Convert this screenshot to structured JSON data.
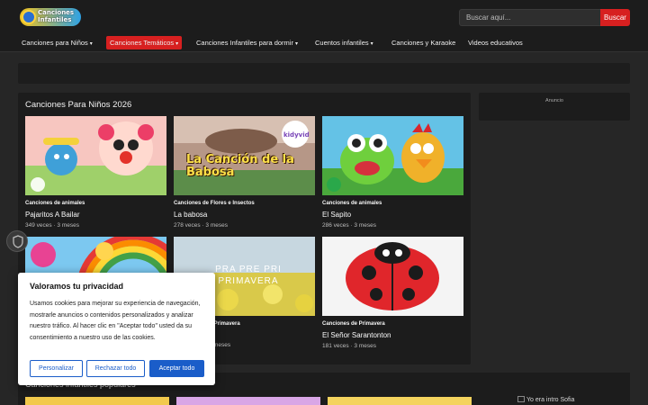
{
  "header": {
    "logo_text": "Canciones Infantiles",
    "search_placeholder": "Buscar aquí...",
    "search_button": "Buscar"
  },
  "nav": [
    {
      "label": "Canciones para Niños",
      "dropdown": true,
      "active": false
    },
    {
      "label": "Canciones Temáticos",
      "dropdown": true,
      "active": true
    },
    {
      "label": "Canciones Infantiles para dormir",
      "dropdown": true,
      "active": false
    },
    {
      "label": "Cuentos infantiles",
      "dropdown": true,
      "active": false
    },
    {
      "label": "Canciones y Karaoke",
      "dropdown": false,
      "active": false
    },
    {
      "label": "Videos educativos",
      "dropdown": false,
      "active": false
    }
  ],
  "main": {
    "section_title": "Canciones Para Niños 2026",
    "cards": [
      {
        "category": "Canciones de animales",
        "title": "Pajaritos A Bailar",
        "views": "349 veces",
        "age": "3 meses",
        "thumb": "pajaritos-thumb"
      },
      {
        "category": "Canciones de Flores e Insectos",
        "title": "La babosa",
        "views": "278 veces",
        "age": "3 meses",
        "thumb": "babosa-thumb",
        "overlay": "La Canción de la Babosa",
        "badge": "kidyvid"
      },
      {
        "category": "Canciones de animales",
        "title": "El Sapito",
        "views": "286 veces",
        "age": "3 meses",
        "thumb": "sapito-thumb"
      },
      {
        "category": "",
        "title": "",
        "views": "",
        "age": "",
        "thumb": "rainbow-thumb"
      },
      {
        "category": "de Primavera",
        "title": "",
        "views": "",
        "age": "meses",
        "thumb": "primavera-thumb",
        "overlay": "PRA PRE PRI PRIMAVERA"
      },
      {
        "category": "Canciones de Primavera",
        "title": "El Señor Sarantonton",
        "views": "181 veces",
        "age": "3 meses",
        "thumb": "ladybug-thumb"
      }
    ]
  },
  "sidebar_ad": {
    "label": "Anuncio"
  },
  "second_section": {
    "title": "Canciones infantiles populares"
  },
  "broken_image": {
    "alt": "Yo era intro Sofia"
  },
  "cookie": {
    "title": "Valoramos tu privacidad",
    "text": "Usamos cookies para mejorar su experiencia de navegación, mostrarle anuncios o contenidos personalizados y analizar nuestro tráfico. Al hacer clic en \"Aceptar todo\" usted da su consentimiento a nuestro uso de las cookies.",
    "btn_customize": "Personalizar",
    "btn_reject": "Rechazar todo",
    "btn_accept": "Aceptar todo"
  },
  "colors": {
    "accent": "#d72020",
    "consent_blue": "#1a5dc9",
    "bg": "#262626",
    "panel": "#1c1c1c"
  }
}
